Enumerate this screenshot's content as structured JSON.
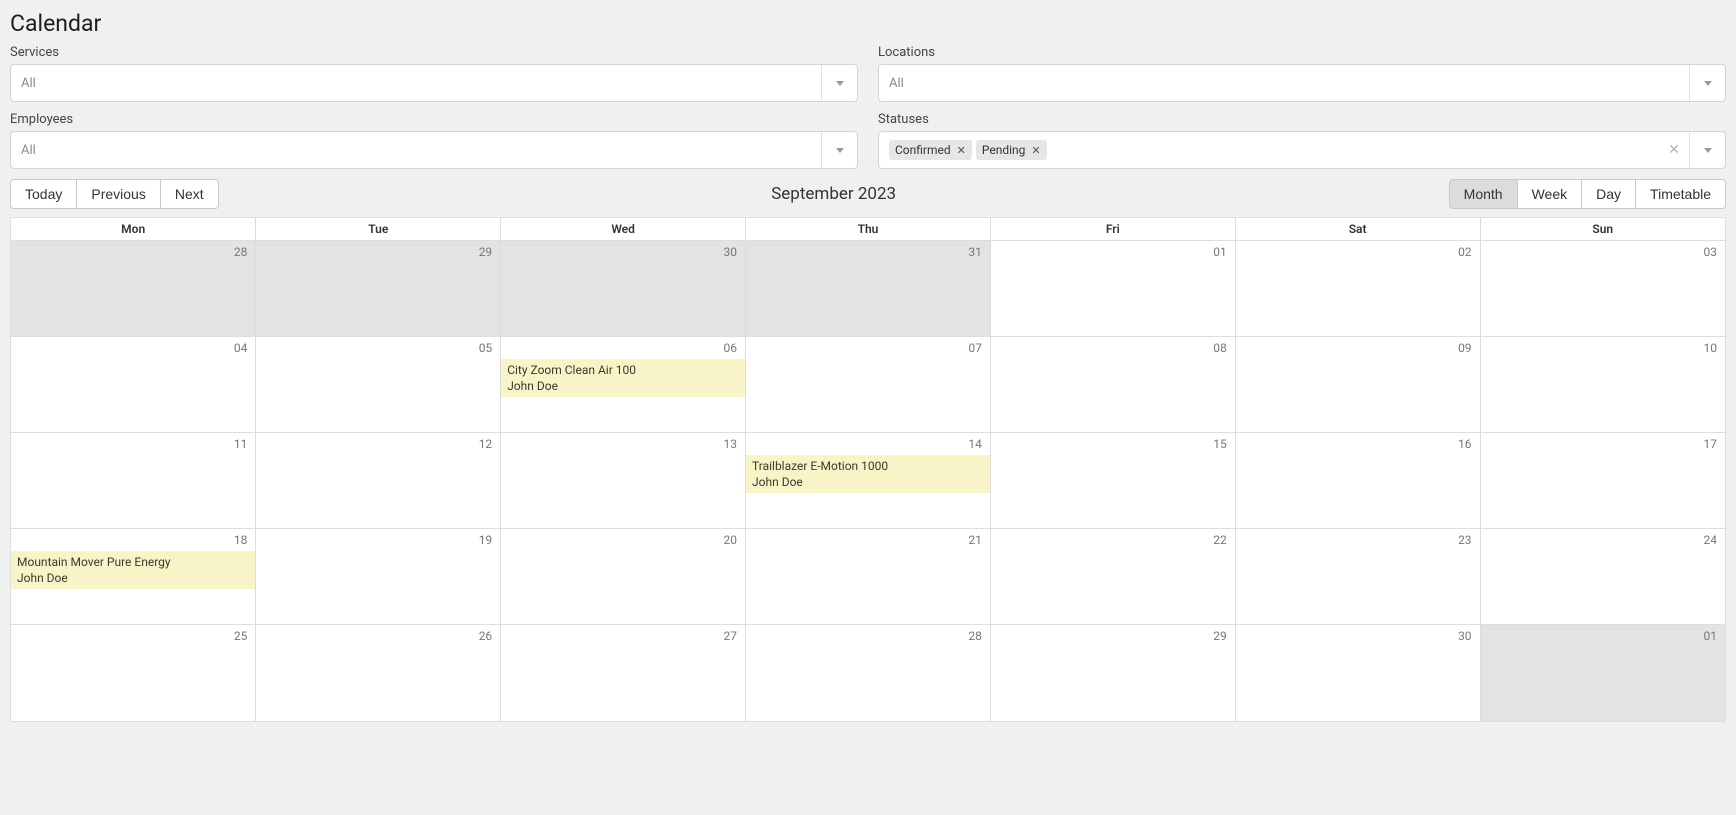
{
  "page_title": "Calendar",
  "filters": {
    "services": {
      "label": "Services",
      "placeholder": "All"
    },
    "locations": {
      "label": "Locations",
      "placeholder": "All"
    },
    "employees": {
      "label": "Employees",
      "placeholder": "All"
    },
    "statuses": {
      "label": "Statuses",
      "tags": [
        "Confirmed",
        "Pending"
      ]
    }
  },
  "nav": {
    "today": "Today",
    "previous": "Previous",
    "next": "Next"
  },
  "current_period": "September 2023",
  "views": {
    "month": "Month",
    "week": "Week",
    "day": "Day",
    "timetable": "Timetable",
    "active": "month"
  },
  "weekdays": [
    "Mon",
    "Tue",
    "Wed",
    "Thu",
    "Fri",
    "Sat",
    "Sun"
  ],
  "weeks": [
    [
      {
        "day": "28",
        "other": true
      },
      {
        "day": "29",
        "other": true
      },
      {
        "day": "30",
        "other": true
      },
      {
        "day": "31",
        "other": true
      },
      {
        "day": "01"
      },
      {
        "day": "02"
      },
      {
        "day": "03"
      }
    ],
    [
      {
        "day": "04"
      },
      {
        "day": "05"
      },
      {
        "day": "06",
        "event": {
          "title": "City Zoom Clean Air 100",
          "person": "John Doe"
        }
      },
      {
        "day": "07"
      },
      {
        "day": "08"
      },
      {
        "day": "09"
      },
      {
        "day": "10"
      }
    ],
    [
      {
        "day": "11"
      },
      {
        "day": "12"
      },
      {
        "day": "13"
      },
      {
        "day": "14",
        "event": {
          "title": "Trailblazer E-Motion 1000",
          "person": "John Doe"
        }
      },
      {
        "day": "15"
      },
      {
        "day": "16"
      },
      {
        "day": "17"
      }
    ],
    [
      {
        "day": "18",
        "event": {
          "title": "Mountain Mover Pure Energy",
          "person": "John Doe"
        }
      },
      {
        "day": "19"
      },
      {
        "day": "20"
      },
      {
        "day": "21"
      },
      {
        "day": "22"
      },
      {
        "day": "23"
      },
      {
        "day": "24"
      }
    ],
    [
      {
        "day": "25"
      },
      {
        "day": "26"
      },
      {
        "day": "27"
      },
      {
        "day": "28"
      },
      {
        "day": "29"
      },
      {
        "day": "30"
      },
      {
        "day": "01",
        "other": true
      }
    ]
  ]
}
